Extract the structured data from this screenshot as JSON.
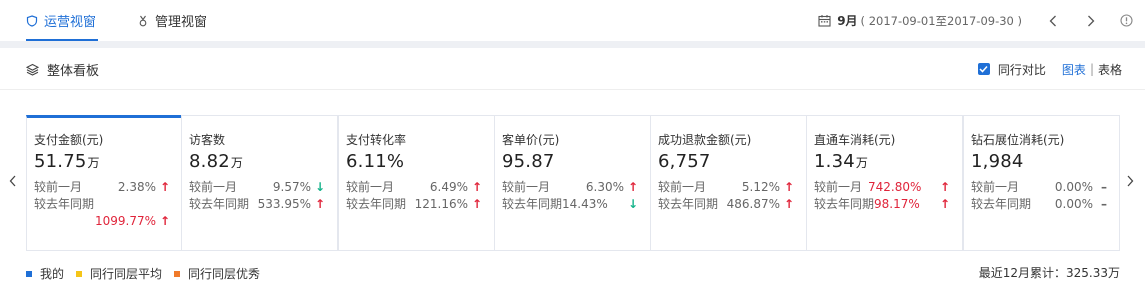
{
  "tabs": [
    {
      "label": "运营视窗",
      "active": true
    },
    {
      "label": "管理视窗",
      "active": false
    }
  ],
  "date": {
    "month": "9月",
    "range": "( 2017-09-01至2017-09-30 )"
  },
  "panel": {
    "title": "整体看板",
    "compare_label": "同行对比",
    "view_chart": "图表",
    "view_sep": "|",
    "view_table": "表格"
  },
  "cards": [
    {
      "label": "支付金额(元)",
      "value": "51.75",
      "unit": "万",
      "row1_name": "较前一月",
      "row1_pct": "2.38%",
      "row1_dir": "up",
      "row2_name": "较去年同期",
      "row2_pct": "1099.77%",
      "row2_dir": "up"
    },
    {
      "label": "访客数",
      "value": "8.82",
      "unit": "万",
      "row1_name": "较前一月",
      "row1_pct": "9.57%",
      "row1_dir": "down",
      "row2_name": "较去年同期",
      "row2_pct": "533.95%",
      "row2_dir": "up"
    },
    {
      "label": "支付转化率",
      "value": "6.11%",
      "unit": "",
      "row1_name": "较前一月",
      "row1_pct": "6.49%",
      "row1_dir": "up",
      "row2_name": "较去年同期",
      "row2_pct": "121.16%",
      "row2_dir": "up"
    },
    {
      "label": "客单价(元)",
      "value": "95.87",
      "unit": "",
      "row1_name": "较前一月",
      "row1_pct": "6.30%",
      "row1_dir": "up",
      "row2_name": "较去年同期",
      "row2_pct": "14.43%",
      "row2_dir": "down"
    },
    {
      "label": "成功退款金额(元)",
      "value": "6,757",
      "unit": "",
      "row1_name": "较前一月",
      "row1_pct": "5.12%",
      "row1_dir": "up",
      "row2_name": "较去年同期",
      "row2_pct": "486.87%",
      "row2_dir": "up"
    },
    {
      "label": "直通车消耗(元)",
      "value": "1.34",
      "unit": "万",
      "row1_name": "较前一月",
      "row1_pct": "742.80%",
      "row1_dir": "up",
      "row2_name": "较去年同期",
      "row2_pct": "98.17%",
      "row2_dir": "up"
    },
    {
      "label": "钻石展位消耗(元)",
      "value": "1,984",
      "unit": "",
      "row1_name": "较前一月",
      "row1_pct": "0.00%",
      "row1_dir": "flat",
      "row2_name": "较去年同期",
      "row2_pct": "0.00%",
      "row2_dir": "flat"
    }
  ],
  "legend": [
    {
      "label": "我的",
      "color": "#1f6fd6"
    },
    {
      "label": "同行同层平均",
      "color": "#f5c518"
    },
    {
      "label": "同行同层优秀",
      "color": "#f07a2a"
    }
  ],
  "total": "最近12月累计：325.33万",
  "colors": {
    "accent": "#1f6fd6",
    "up": "#e0253b",
    "down": "#16b48b"
  }
}
